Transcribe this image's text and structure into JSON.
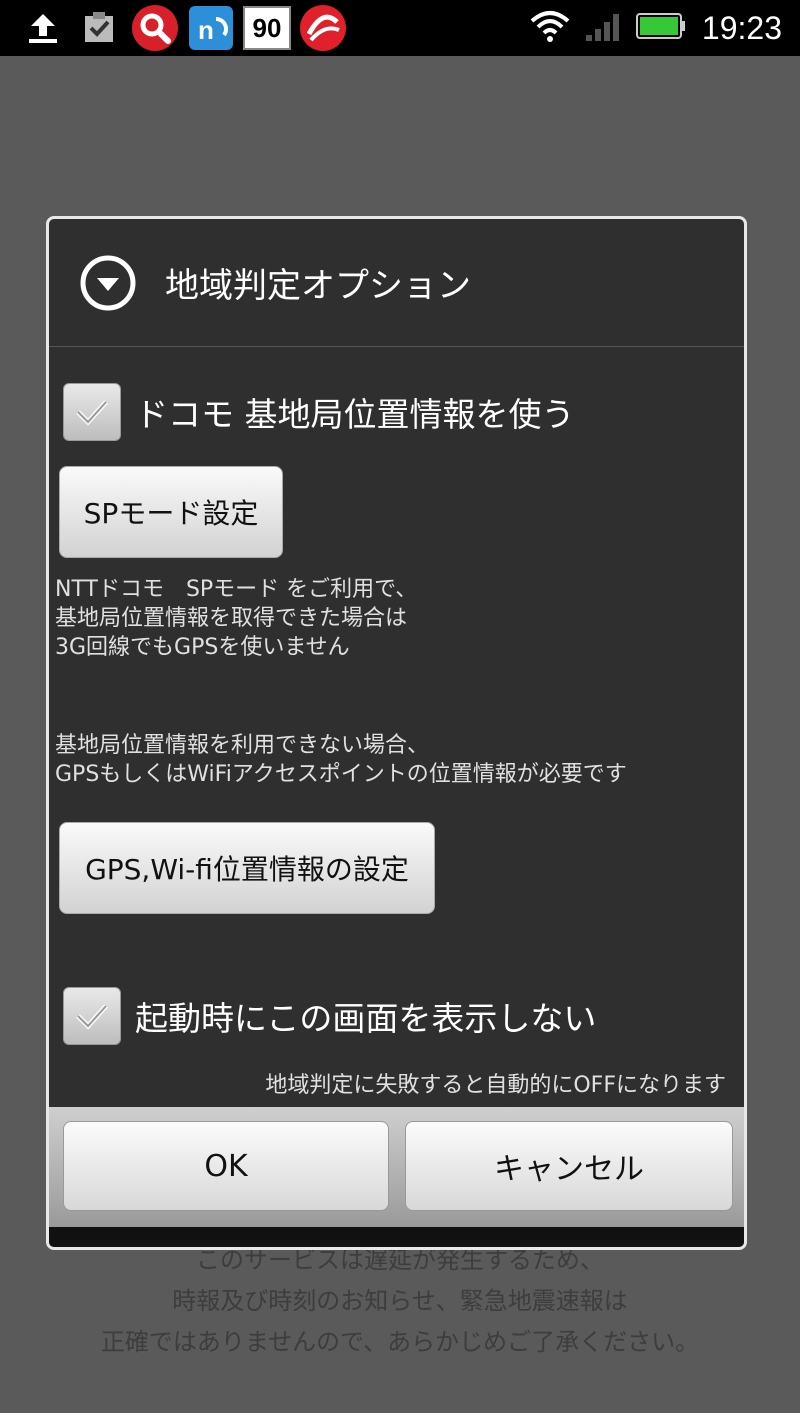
{
  "status_bar": {
    "time": "19:23",
    "badge_number": "90",
    "icons_left": [
      "upload-icon",
      "checklist-icon",
      "search-app-icon",
      "rss-app-icon",
      "badge-90-icon",
      "trend-app-icon"
    ],
    "icons_right": [
      "wifi-icon",
      "signal-icon",
      "battery-icon"
    ],
    "accent_battery": "#37c837"
  },
  "background": {
    "notice_lines": [
      "このサービスは遅延が発生するため、",
      "時報及び時刻のお知らせ、緊急地震速報は",
      "正確ではありませんので、あらかじめご了承ください。"
    ]
  },
  "dialog": {
    "title": "地域判定オプション",
    "title_icon": "chevron-down-circle-icon",
    "docomo_checkbox": {
      "label": "ドコモ 基地局位置情報を使う",
      "checked": true
    },
    "sp_mode_button": "SPモード設定",
    "sp_description": [
      "NTTドコモ　SPモード をご利用で、",
      "基地局位置情報を取得できた場合は",
      "3G回線でもGPSを使いません"
    ],
    "fallback_description": [
      "基地局位置情報を利用できない場合、",
      "GPSもしくはWiFiアクセスポイントの位置情報が必要です"
    ],
    "gps_wifi_button": "GPS,Wi-fi位置情報の設定",
    "startup_checkbox": {
      "label": "起動時にこの画面を表示しない",
      "checked": true
    },
    "startup_note": "地域判定に失敗すると自動的にOFFになります",
    "ok_button": "OK",
    "cancel_button": "キャンセル"
  }
}
